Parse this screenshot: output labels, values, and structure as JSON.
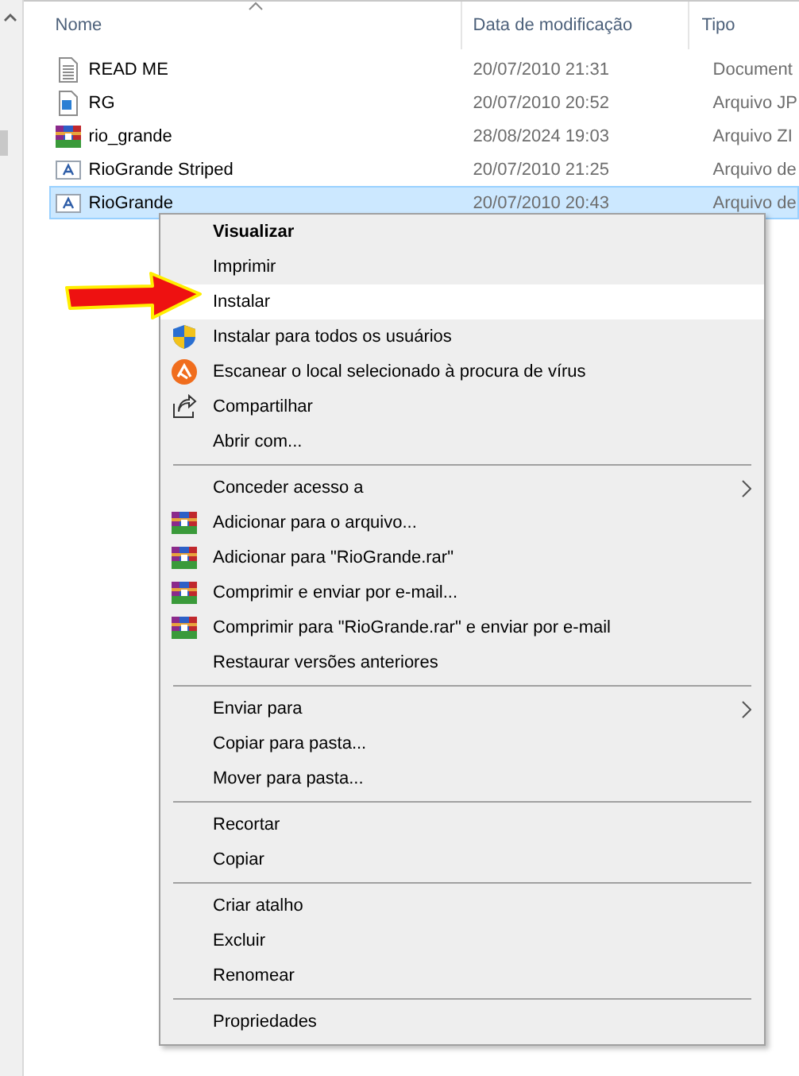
{
  "columns": [
    "Nome",
    "Data de modificação",
    "Tipo"
  ],
  "files": [
    {
      "kind": "text",
      "name": "READ ME",
      "date": "20/07/2010 21:31",
      "type": "Document",
      "selected": false
    },
    {
      "kind": "image",
      "name": "RG",
      "date": "20/07/2010 20:52",
      "type": "Arquivo JP",
      "selected": false
    },
    {
      "kind": "archive",
      "name": "rio_grande",
      "date": "28/08/2024 19:03",
      "type": "Arquivo ZI",
      "selected": false
    },
    {
      "kind": "font",
      "name": "RioGrande Striped",
      "date": "20/07/2010 21:25",
      "type": "Arquivo de",
      "selected": false
    },
    {
      "kind": "font",
      "name": "RioGrande",
      "date": "20/07/2010 20:43",
      "type": "Arquivo de",
      "selected": true
    }
  ],
  "menu": {
    "groups": [
      [
        {
          "kind": "plain",
          "label": "Visualizar",
          "default": true,
          "selected": false
        },
        {
          "kind": "plain",
          "label": "Imprimir",
          "default": false,
          "selected": false
        },
        {
          "kind": "plain",
          "label": "Instalar",
          "default": false,
          "selected": true
        },
        {
          "kind": "admin",
          "label": "Instalar para todos os usuários",
          "default": false,
          "selected": false
        },
        {
          "kind": "scan",
          "label": "Escanear o local selecionado à procura de vírus",
          "default": false,
          "selected": false
        },
        {
          "kind": "share",
          "label": "Compartilhar",
          "default": false,
          "selected": false
        },
        {
          "kind": "plain",
          "label": "Abrir com...",
          "default": false,
          "selected": false
        }
      ],
      [
        {
          "kind": "plain",
          "label": "Conceder acesso a",
          "default": false,
          "selected": false,
          "submenu": true
        },
        {
          "kind": "archive",
          "label": "Adicionar para o arquivo...",
          "default": false,
          "selected": false
        },
        {
          "kind": "archive",
          "label": "Adicionar para \"RioGrande.rar\"",
          "default": false,
          "selected": false
        },
        {
          "kind": "archive",
          "label": "Comprimir e enviar por e-mail...",
          "default": false,
          "selected": false
        },
        {
          "kind": "archive",
          "label": "Comprimir para \"RioGrande.rar\" e enviar por e-mail",
          "default": false,
          "selected": false
        },
        {
          "kind": "plain",
          "label": "Restaurar versões anteriores",
          "default": false,
          "selected": false
        }
      ],
      [
        {
          "kind": "plain",
          "label": "Enviar para",
          "default": false,
          "selected": false,
          "submenu": true
        },
        {
          "kind": "plain",
          "label": "Copiar para pasta...",
          "default": false,
          "selected": false
        },
        {
          "kind": "plain",
          "label": "Mover para pasta...",
          "default": false,
          "selected": false
        }
      ],
      [
        {
          "kind": "plain",
          "label": "Recortar",
          "default": false,
          "selected": false
        },
        {
          "kind": "plain",
          "label": "Copiar",
          "default": false,
          "selected": false
        }
      ],
      [
        {
          "kind": "plain",
          "label": "Criar atalho",
          "default": false,
          "selected": false
        },
        {
          "kind": "plain",
          "label": "Excluir",
          "default": false,
          "selected": false
        },
        {
          "kind": "plain",
          "label": "Renomear",
          "default": false,
          "selected": false
        }
      ],
      [
        {
          "kind": "plain",
          "label": "Propriedades",
          "default": false,
          "selected": false
        }
      ]
    ]
  }
}
